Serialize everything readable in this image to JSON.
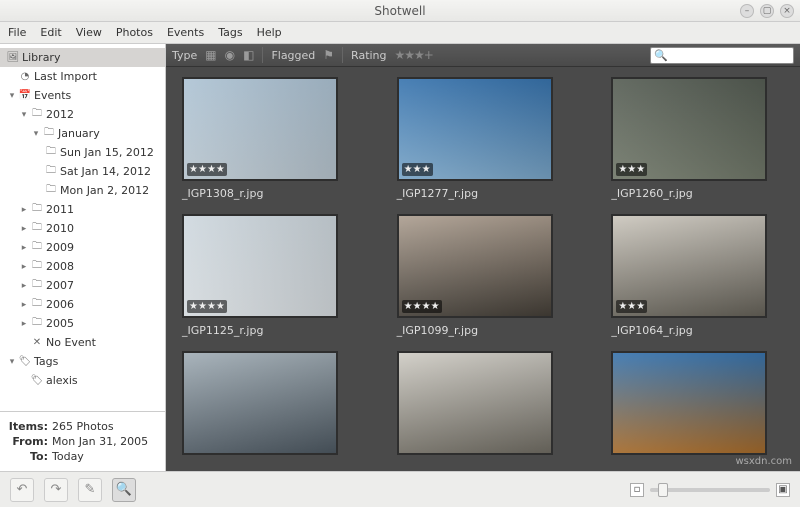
{
  "window": {
    "title": "Shotwell"
  },
  "menubar": [
    "File",
    "Edit",
    "View",
    "Photos",
    "Events",
    "Tags",
    "Help"
  ],
  "sidebar": {
    "library_label": "Library",
    "last_import_label": "Last Import",
    "events_label": "Events",
    "years": {
      "y2012": {
        "label": "2012",
        "jan_label": "January",
        "days": [
          "Sun Jan 15, 2012",
          "Sat Jan 14, 2012",
          "Mon Jan 2, 2012"
        ]
      },
      "others": [
        "2011",
        "2010",
        "2009",
        "2008",
        "2007",
        "2006",
        "2005"
      ]
    },
    "no_event_label": "No Event",
    "tags_label": "Tags",
    "tag_items": [
      "alexis"
    ]
  },
  "status": {
    "items_label": "Items:",
    "items_value": "265 Photos",
    "from_label": "From:",
    "from_value": "Mon Jan 31, 2005",
    "to_label": "To:",
    "to_value": "Today"
  },
  "toolbar": {
    "type_label": "Type",
    "flagged_label": "Flagged",
    "rating_label": "Rating",
    "search_placeholder": ""
  },
  "thumbs": [
    {
      "caption": "_IGP1308_r.jpg",
      "rating": 4,
      "pal": "p1"
    },
    {
      "caption": "_IGP1277_r.jpg",
      "rating": 3,
      "pal": "p2"
    },
    {
      "caption": "_IGP1260_r.jpg",
      "rating": 3,
      "pal": "p3"
    },
    {
      "caption": "_IGP1125_r.jpg",
      "rating": 4,
      "pal": "p4"
    },
    {
      "caption": "_IGP1099_r.jpg",
      "rating": 4,
      "pal": "p5"
    },
    {
      "caption": "_IGP1064_r.jpg",
      "rating": 3,
      "pal": "p6"
    },
    {
      "caption": "",
      "rating": 0,
      "pal": "p7"
    },
    {
      "caption": "",
      "rating": 0,
      "pal": "p8"
    },
    {
      "caption": "",
      "rating": 0,
      "pal": "p9"
    }
  ],
  "watermark": "wsxdn.com"
}
